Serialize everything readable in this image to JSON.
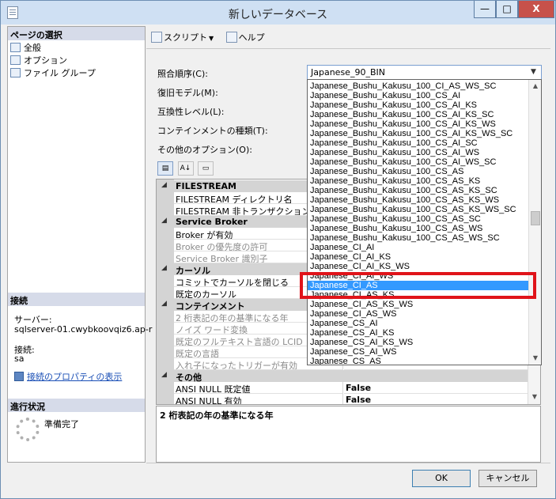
{
  "window": {
    "title": "新しいデータベース",
    "minimize_label": "—",
    "maximize_label": "□",
    "close_label": "X"
  },
  "left": {
    "select_page_header": "ページの選択",
    "pages": [
      "全般",
      "オプション",
      "ファイル グループ"
    ],
    "connection_header": "接続",
    "server_label": "サーバー:",
    "server_value": "sqlserver-01.cwybkoovqiz6.ap-r",
    "connection_label": "接続:",
    "connection_value": "sa",
    "connection_props_link": "接続のプロパティの表示",
    "progress_header": "進行状況",
    "progress_status": "準備完了"
  },
  "toolbar": {
    "script_label": "スクリプト",
    "help_label": "ヘルプ"
  },
  "fields": {
    "collation_label": "照合順序(C):",
    "recovery_label": "復旧モデル(M):",
    "compat_label": "互換性レベル(L):",
    "containment_label": "コンテインメントの種類(T):",
    "other_options_label": "その他のオプション(O):"
  },
  "collation_combo": {
    "value": "Japanese_90_BIN",
    "arrow": "▼"
  },
  "collation_list": {
    "items": [
      "Japanese_Bushu_Kakusu_100_CI_AS_WS_SC",
      "Japanese_Bushu_Kakusu_100_CS_AI",
      "Japanese_Bushu_Kakusu_100_CS_AI_KS",
      "Japanese_Bushu_Kakusu_100_CS_AI_KS_SC",
      "Japanese_Bushu_Kakusu_100_CS_AI_KS_WS",
      "Japanese_Bushu_Kakusu_100_CS_AI_KS_WS_SC",
      "Japanese_Bushu_Kakusu_100_CS_AI_SC",
      "Japanese_Bushu_Kakusu_100_CS_AI_WS",
      "Japanese_Bushu_Kakusu_100_CS_AI_WS_SC",
      "Japanese_Bushu_Kakusu_100_CS_AS",
      "Japanese_Bushu_Kakusu_100_CS_AS_KS",
      "Japanese_Bushu_Kakusu_100_CS_AS_KS_SC",
      "Japanese_Bushu_Kakusu_100_CS_AS_KS_WS",
      "Japanese_Bushu_Kakusu_100_CS_AS_KS_WS_SC",
      "Japanese_Bushu_Kakusu_100_CS_AS_SC",
      "Japanese_Bushu_Kakusu_100_CS_AS_WS",
      "Japanese_Bushu_Kakusu_100_CS_AS_WS_SC",
      "Japanese_CI_AI",
      "Japanese_CI_AI_KS",
      "Japanese_CI_AI_KS_WS",
      "Japanese_CI_AI_WS",
      "Japanese_CI_AS",
      "Japanese_CI_AS_KS",
      "Japanese_CI_AS_KS_WS",
      "Japanese_CI_AS_WS",
      "Japanese_CS_AI",
      "Japanese_CS_AI_KS",
      "Japanese_CS_AI_KS_WS",
      "Japanese_CS_AI_WS",
      "Japanese_CS_AS"
    ],
    "selected_index": 21
  },
  "grid": {
    "cat_filestream": "FILESTREAM",
    "fs_dir": "FILESTREAM ディレクトリ名",
    "fs_nontx": "FILESTREAM 非トランザクション ア",
    "cat_broker": "Service Broker",
    "broker_enabled": "Broker が有効",
    "broker_priority": "Broker の優先度の許可",
    "broker_id": "Service Broker 識別子",
    "cat_cursor": "カーソル",
    "cursor_close": "コミットでカーソルを閉じる",
    "cursor_default": "既定のカーソル",
    "cat_containment": "コンテインメント",
    "cont_two_digit": "2 桁表記の年の基準になる年",
    "cont_noise": "ノイズ ワード変換",
    "cont_fulltext": "既定のフルテキスト言語の LCID",
    "cont_lang": "既定の言語",
    "cont_nested": "入れ子になったトリガーが有効",
    "cat_other": "その他",
    "ansi_null_default": "ANSI NULL 既定値",
    "ansi_null_default_val": "False",
    "ansi_null_enabled": "ANSI NULL 有効",
    "ansi_null_enabled_val": "False"
  },
  "description": "2 桁表記の年の基準になる年",
  "buttons": {
    "ok": "OK",
    "cancel": "キャンセル"
  },
  "colors": {
    "selection": "#3399ff",
    "highlight_box": "#e0141a",
    "title_bar": "#cfe0f3"
  }
}
